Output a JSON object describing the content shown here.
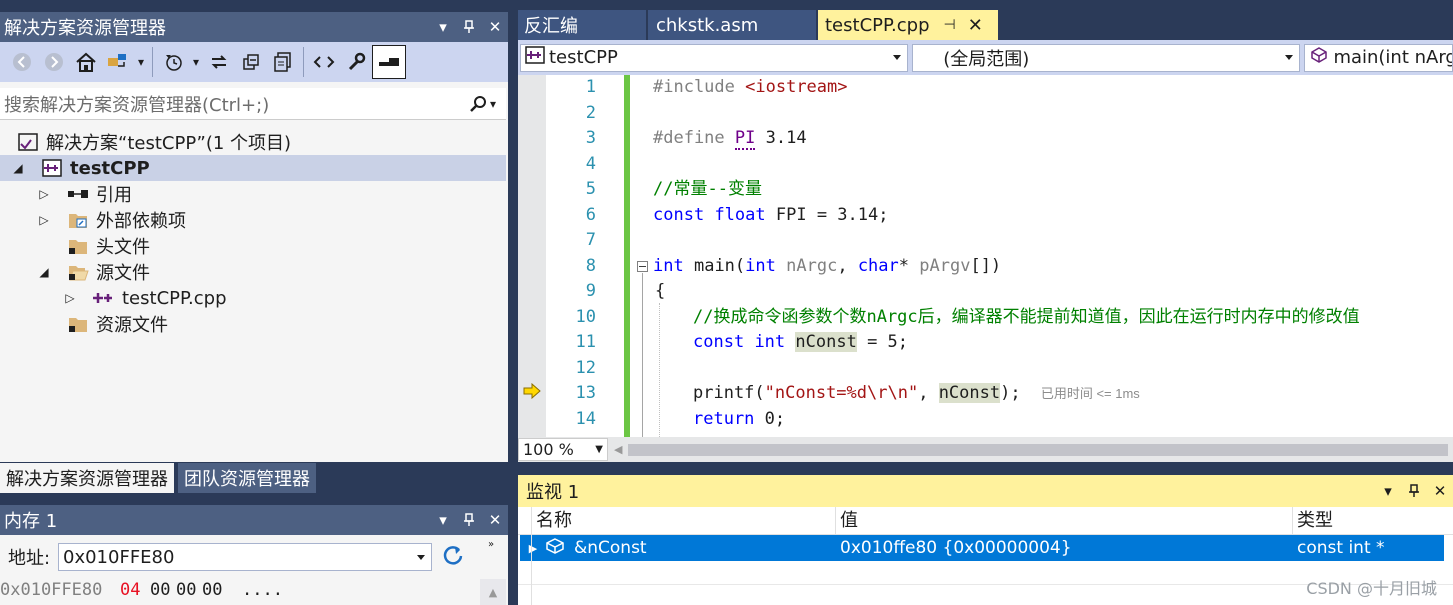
{
  "solution_explorer": {
    "title": "解决方案资源管理器",
    "search_placeholder": "搜索解决方案资源管理器(Ctrl+;)",
    "solution_label": "解决方案“testCPP”(1 个项目)",
    "project_label": "testCPP",
    "items": [
      {
        "label": "引用"
      },
      {
        "label": "外部依赖项"
      },
      {
        "label": "头文件"
      },
      {
        "label": "源文件"
      },
      {
        "label": "testCPP.cpp"
      },
      {
        "label": "资源文件"
      }
    ]
  },
  "bottom_tabs": {
    "solution_tab": "解决方案资源管理器",
    "team_tab": "团队资源管理器"
  },
  "memory": {
    "title": "内存 1",
    "address_label": "地址:",
    "address_value": "0x010FFE80",
    "row_addr": "0x010FFE80",
    "row_bytes": [
      "04",
      "00",
      "00",
      "00"
    ],
    "row_ascii": "...."
  },
  "editor": {
    "tabs": [
      "反汇编",
      "chkstk.asm",
      "testCPP.cpp"
    ],
    "active_tab": "testCPP.cpp",
    "project_dropdown": "testCPP",
    "scope_dropdown": "(全局范围)",
    "member_dropdown": "main(int nArg",
    "zoom": "100 %",
    "elapsed_hint": "已用时间 <= 1ms",
    "line_numbers": [
      "1",
      "2",
      "3",
      "4",
      "5",
      "6",
      "7",
      "8",
      "9",
      "10",
      "11",
      "12",
      "13",
      "14"
    ],
    "code": {
      "l1_pp": "#include",
      "l1_inc": "<iostream>",
      "l3_pp": "#define",
      "l3_macro": "PI",
      "l3_val": "3.14",
      "l5_cm": "//常量--变量",
      "l6_kw1": "const",
      "l6_kw2": "float",
      "l6_rest": "FPI = 3.14;",
      "l8_kw1": "int",
      "l8_name": "main(",
      "l8_kw2": "int",
      "l8_p1": "nArgc",
      "l8_comma": ",",
      "l8_kw3": "char",
      "l8_star": "*",
      "l8_p2": "pArgv",
      "l8_end": "[])",
      "l9": "{",
      "l10_cm": "//换成命令函参数个数nArgc后，编译器不能提前知道值，因此在运行时内存中的修改值",
      "l11_kw1": "const",
      "l11_kw2": "int",
      "l11_var": "nConst",
      "l11_rest": "= 5;",
      "l13_fn": "printf(",
      "l13_str": "\"nConst=%d\\r\\n\"",
      "l13_comma": ",",
      "l13_var": "nConst",
      "l13_end": ");",
      "l14_kw": "return",
      "l14_rest": "0;"
    }
  },
  "watch": {
    "title": "监视 1",
    "col_name": "名称",
    "col_value": "值",
    "col_type": "类型",
    "row_name": "&nConst",
    "row_value": "0x010ffe80 {0x00000004}",
    "row_type": "const int *"
  },
  "watermark": "CSDN @十月旧城",
  "colors": {
    "accent": "#0078d7",
    "title_bar": "#4d6082",
    "watch_title": "#fff29d",
    "active_tab": "#fff29d"
  }
}
